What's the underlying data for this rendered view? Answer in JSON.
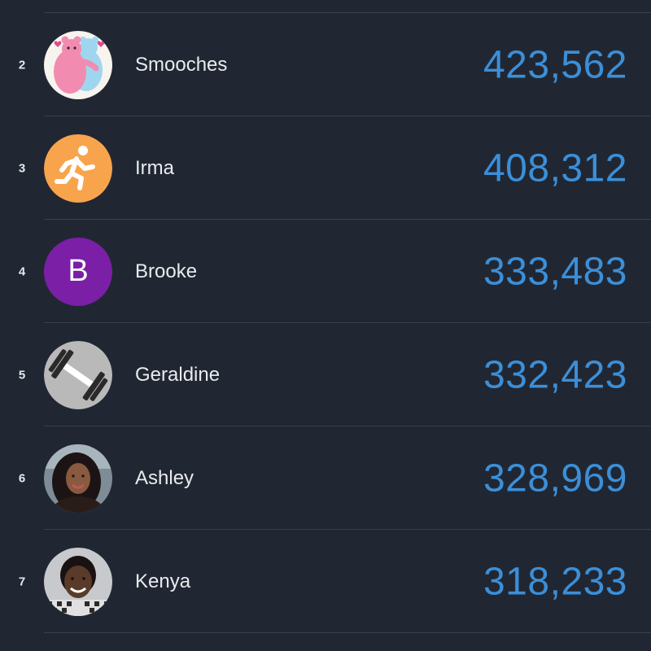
{
  "leaderboard": {
    "rows": [
      {
        "rank": "2",
        "name": "Smooches",
        "score": "423,562",
        "avatar": "hugging-bears-icon"
      },
      {
        "rank": "3",
        "name": "Irma",
        "score": "408,312",
        "avatar": "running-person-icon"
      },
      {
        "rank": "4",
        "name": "Brooke",
        "score": "333,483",
        "avatar": "letter-avatar",
        "initial": "B"
      },
      {
        "rank": "5",
        "name": "Geraldine",
        "score": "332,423",
        "avatar": "dumbbell-icon"
      },
      {
        "rank": "6",
        "name": "Ashley",
        "score": "328,969",
        "avatar": "profile-photo"
      },
      {
        "rank": "7",
        "name": "Kenya",
        "score": "318,233",
        "avatar": "profile-photo"
      }
    ]
  },
  "colors": {
    "background": "#212732",
    "score": "#3b8fd9",
    "text": "#e9ebee",
    "divider": "#3a404b",
    "orange_avatar": "#f8a44d",
    "purple_avatar": "#7a1fa6",
    "gray_avatar": "#b9b9b9"
  }
}
